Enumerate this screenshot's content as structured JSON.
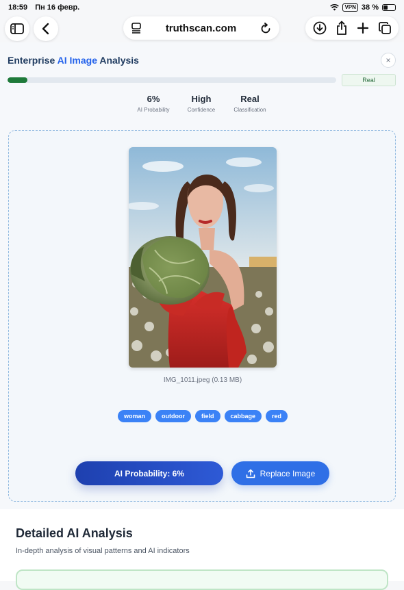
{
  "status": {
    "time": "18:59",
    "date": "Пн 16 февр.",
    "vpn": "VPN",
    "battery": "38 %",
    "battery_level": 0.38
  },
  "browser": {
    "url": "truthscan.com",
    "icons": [
      "sidebar-icon",
      "back-icon",
      "page-menu-icon",
      "reload-icon",
      "download-icon",
      "share-icon",
      "new-tab-icon",
      "tabs-icon"
    ]
  },
  "analysis": {
    "title_parts": [
      "Enterprise ",
      "AI Image",
      " Analysis"
    ],
    "close_glyph": "×",
    "verdict": "Real",
    "progress": 0.06,
    "accent_color": "#1f7a3a",
    "stats": [
      {
        "value": "6%",
        "label": "AI Probability"
      },
      {
        "value": "High",
        "label": "Confidence"
      },
      {
        "value": "Real",
        "label": "Classification"
      }
    ]
  },
  "upload": {
    "file_name": "IMG_1011.jpeg (0.13 MB)",
    "tags": [
      "woman",
      "outdoor",
      "field",
      "cabbage",
      "red"
    ],
    "probability_button": "AI Probability: 6%",
    "replace_button": "Replace Image"
  },
  "detail": {
    "title": "Detailed AI Analysis",
    "subtitle": "In-depth analysis of visual patterns and AI indicators"
  }
}
